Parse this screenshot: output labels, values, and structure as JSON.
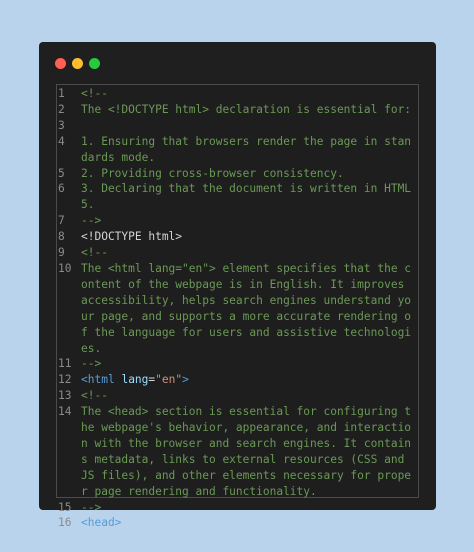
{
  "colors": {
    "background": "#b9d3ec",
    "window": "#1f1f1f",
    "traffic_red": "#ff5f57",
    "traffic_yellow": "#febc2e",
    "traffic_green": "#28c840",
    "comment": "#6a9955",
    "tag": "#569cd6",
    "attribute": "#9cdcfe",
    "string": "#ce9178"
  },
  "lines": [
    {
      "n": "1",
      "text": "<!--"
    },
    {
      "n": "2",
      "text": "The <!DOCTYPE html> declaration is essential for:"
    },
    {
      "n": "3",
      "text": ""
    },
    {
      "n": "4",
      "text": "1. Ensuring that browsers render the page in standards mode."
    },
    {
      "n": "5",
      "text": "2. Providing cross-browser consistency."
    },
    {
      "n": "6",
      "text": "3. Declaring that the document is written in HTML5."
    },
    {
      "n": "7",
      "text": "-->"
    },
    {
      "n": "8",
      "text": "<!DOCTYPE html>"
    },
    {
      "n": "9",
      "text": "<!--"
    },
    {
      "n": "10",
      "text": "The <html lang=\"en\"> element specifies that the content of the webpage is in English. It improves accessibility, helps search engines understand your page, and supports a more accurate rendering of the language for users and assistive technologies."
    },
    {
      "n": "11",
      "text": "-->"
    },
    {
      "n": "12",
      "open": "<",
      "tagname": "html",
      "attrname": "lang",
      "eq": "=",
      "attrval": "\"en\"",
      "close": ">"
    },
    {
      "n": "13",
      "text": "<!--"
    },
    {
      "n": "14",
      "text": "The <head> section is essential for configuring the webpage's behavior, appearance, and interaction with the browser and search engines. It contains metadata, links to external resources (CSS and JS files), and other elements necessary for proper page rendering and functionality."
    },
    {
      "n": "15",
      "text": "-->"
    },
    {
      "n": "16",
      "text": "<head>"
    }
  ]
}
